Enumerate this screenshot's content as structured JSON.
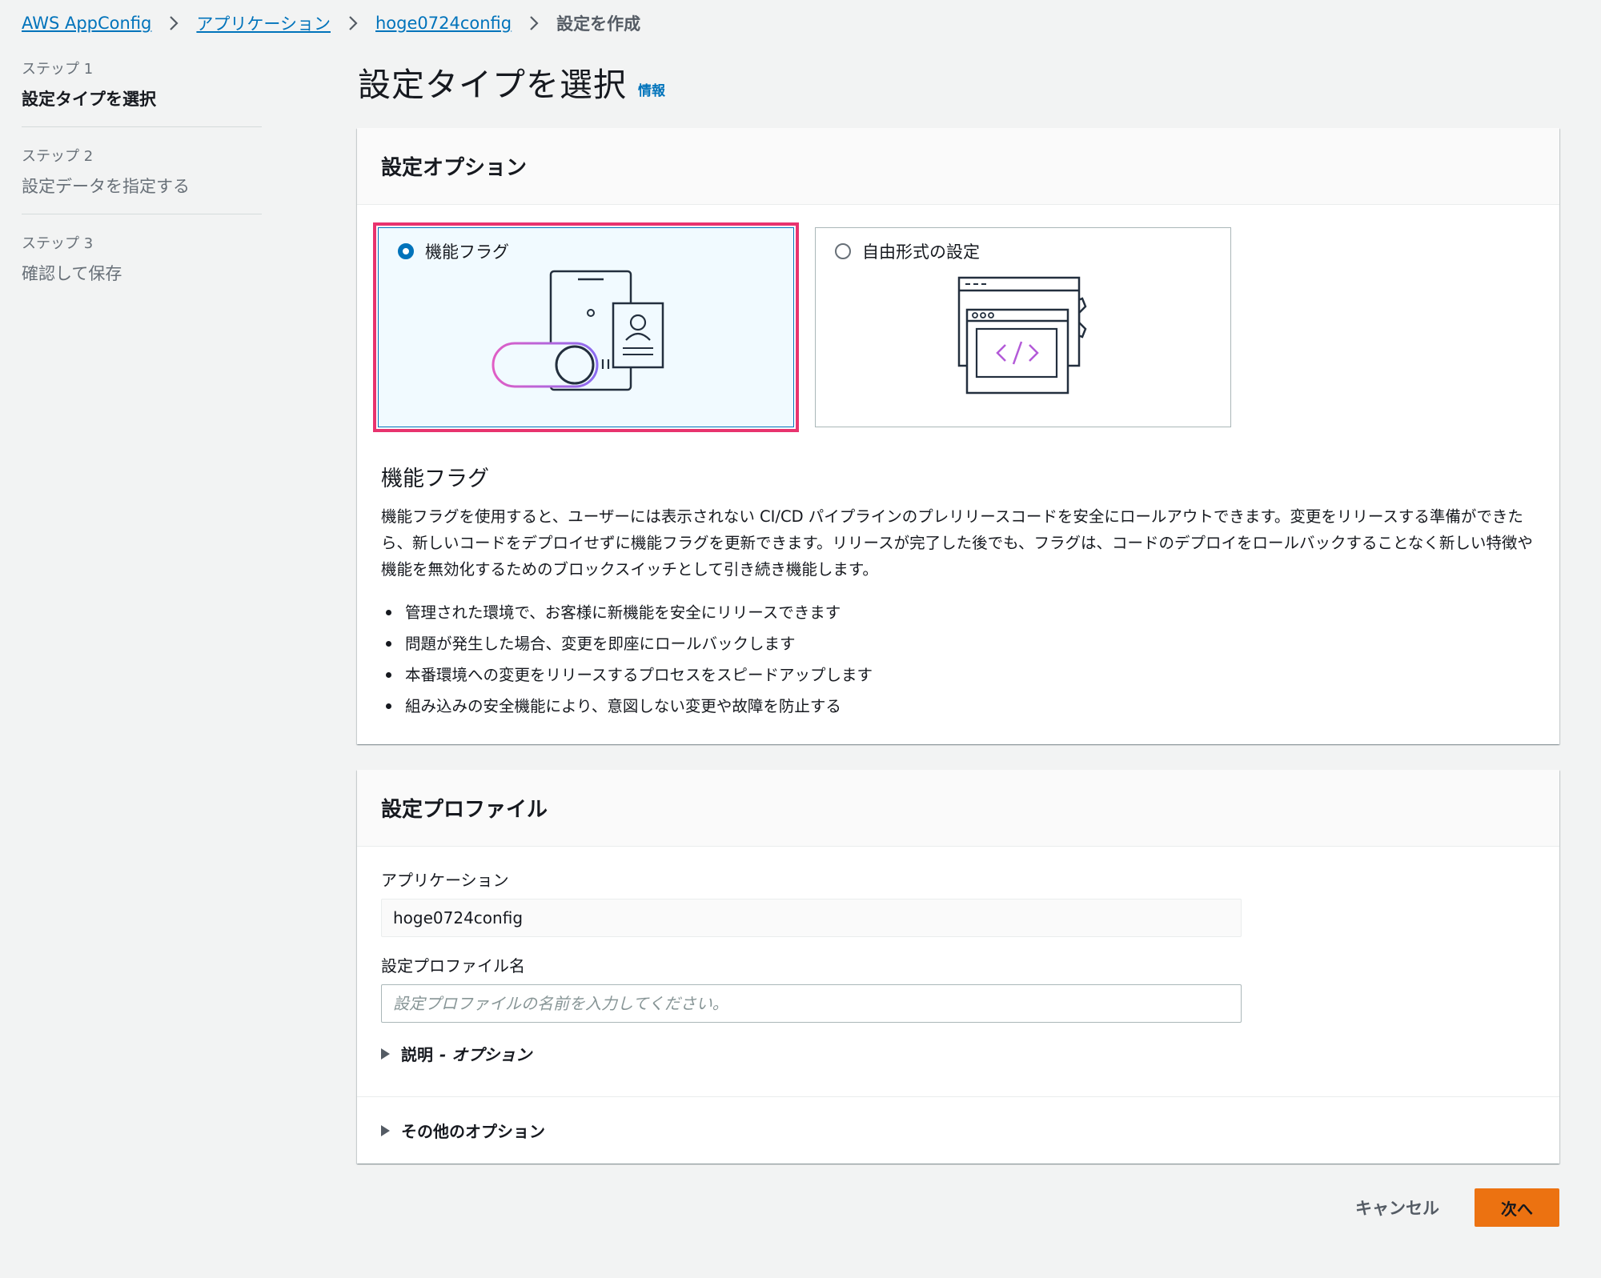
{
  "breadcrumb": {
    "items": [
      "AWS AppConfig",
      "アプリケーション",
      "hoge0724config"
    ],
    "current": "設定を作成"
  },
  "steps": [
    {
      "num": "ステップ 1",
      "title": "設定タイプを選択"
    },
    {
      "num": "ステップ 2",
      "title": "設定データを指定する"
    },
    {
      "num": "ステップ 3",
      "title": "確認して保存"
    }
  ],
  "page": {
    "title": "設定タイプを選択",
    "info": "情報"
  },
  "options_panel": {
    "title": "設定オプション",
    "tiles": [
      {
        "label": "機能フラグ",
        "selected": true,
        "icon": "feature-flag-toggle-illustration"
      },
      {
        "label": "自由形式の設定",
        "selected": false,
        "icon": "code-window-gear-illustration"
      }
    ],
    "description": {
      "title": "機能フラグ",
      "text": "機能フラグを使用すると、ユーザーには表示されない CI/CD パイプラインのプレリリースコードを安全にロールアウトできます。変更をリリースする準備ができたら、新しいコードをデプロイせずに機能フラグを更新できます。リリースが完了した後でも、フラグは、コードのデプロイをロールバックすることなく新しい特徴や機能を無効化するためのブロックスイッチとして引き続き機能します。",
      "bullets": [
        "管理された環境で、お客様に新機能を安全にリリースできます",
        "問題が発生した場合、変更を即座にロールバックします",
        "本番環境への変更をリリースするプロセスをスピードアップします",
        "組み込みの安全機能により、意図しない変更や故障を防止する"
      ]
    }
  },
  "profile_panel": {
    "title": "設定プロファイル",
    "app_label": "アプリケーション",
    "app_value": "hoge0724config",
    "name_label": "設定プロファイル名",
    "name_placeholder": "設定プロファイルの名前を入力してください。",
    "desc_expander": "説明",
    "desc_optional": "- オプション",
    "other_expander": "その他のオプション"
  },
  "footer": {
    "cancel": "キャンセル",
    "next": "次へ"
  },
  "colors": {
    "primary": "#ec7211",
    "link": "#0073bb",
    "highlight": "#e8336e"
  }
}
